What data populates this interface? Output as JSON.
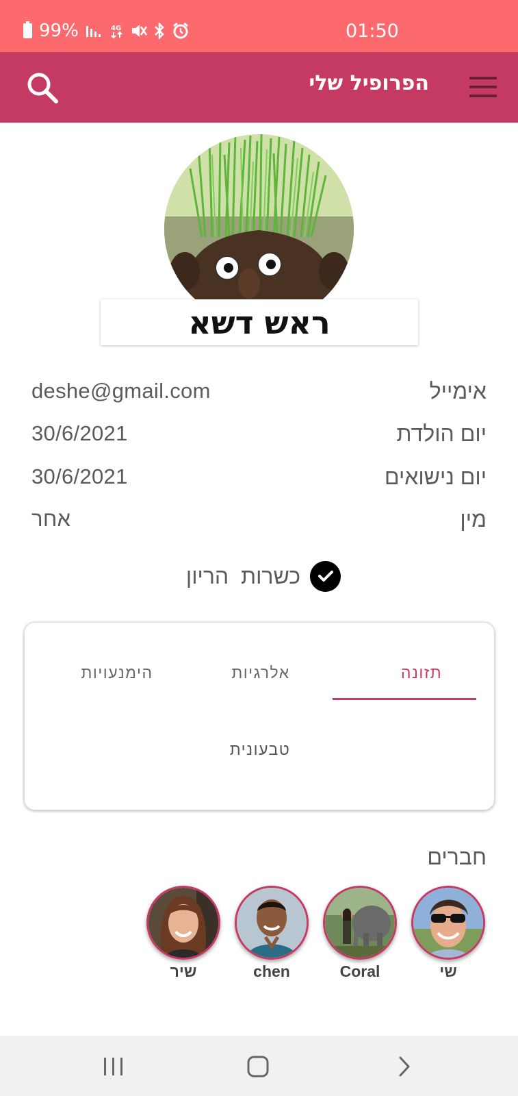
{
  "status_bar": {
    "battery": "99%",
    "time": "01:50",
    "icons": [
      "battery-icon",
      "signal-icon",
      "4g-icon",
      "mute-icon",
      "bluetooth-icon",
      "alarm-icon"
    ]
  },
  "app_bar": {
    "title": "הפרופיל שלי",
    "icons": [
      "search-icon",
      "menu-icon"
    ],
    "color": "#c53a63"
  },
  "profile": {
    "name": "ראש דשא"
  },
  "info": [
    {
      "label": "אימייל",
      "value": "deshe@gmail.com"
    },
    {
      "label": "יום הולדת",
      "value": "30/6/2021"
    },
    {
      "label": "יום נישואים",
      "value": "30/6/2021"
    },
    {
      "label": "מין",
      "value": "אחר"
    }
  ],
  "kashrut": {
    "text": "כשרות  הריון",
    "icon": "check-circle-icon"
  },
  "tabs": {
    "items": [
      "תזונה",
      "אלרגיות",
      "הימנעויות"
    ],
    "active_index": 0,
    "content": "טבעונית"
  },
  "friends": {
    "title": "חברים",
    "items": [
      {
        "name": "שי"
      },
      {
        "name": "Coral"
      },
      {
        "name": "chen"
      },
      {
        "name": "שיר"
      }
    ]
  },
  "nav_bar": {
    "icons": [
      "recent-apps-icon",
      "home-icon",
      "back-icon"
    ]
  }
}
